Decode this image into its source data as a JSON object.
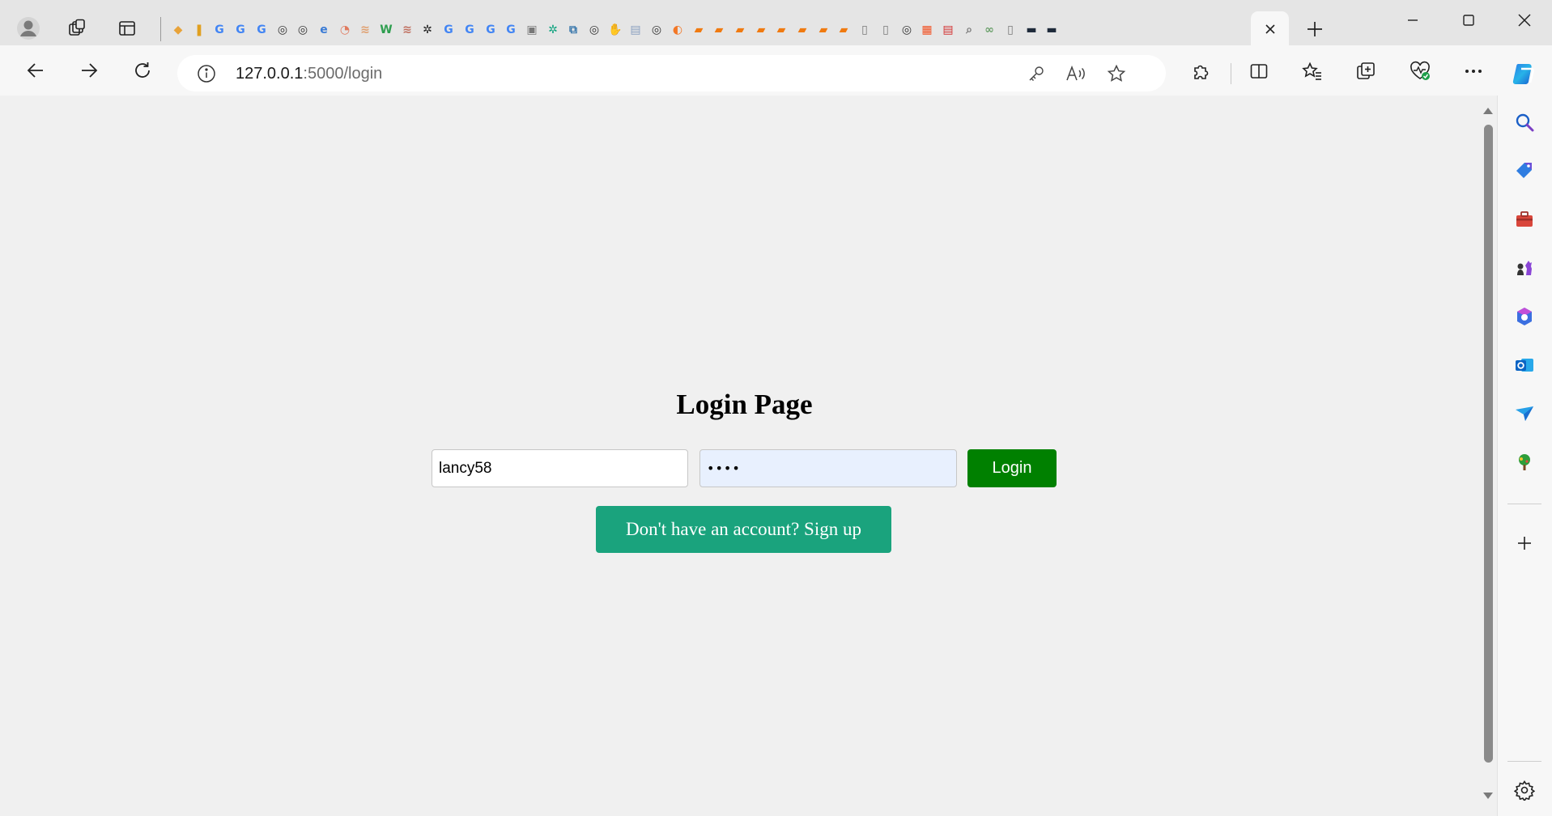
{
  "browser": {
    "address_bar": {
      "host": "127.0.0.1",
      "path": ":5000/login"
    },
    "pinned_tabs": [
      {
        "icon": "multicolor-app-icon",
        "glyph": "◆",
        "color": "#e8a33a"
      },
      {
        "icon": "bars-icon",
        "glyph": "❚",
        "color": "#e0a020"
      },
      {
        "icon": "google-icon",
        "glyph": "G",
        "color": "#4285f4"
      },
      {
        "icon": "google-icon",
        "glyph": "G",
        "color": "#4285f4"
      },
      {
        "icon": "google-icon",
        "glyph": "G",
        "color": "#4285f4"
      },
      {
        "icon": "github-icon",
        "glyph": "◎",
        "color": "#333333"
      },
      {
        "icon": "github-icon",
        "glyph": "◎",
        "color": "#333333"
      },
      {
        "icon": "edge-e-icon",
        "glyph": "e",
        "color": "#3a7bd5"
      },
      {
        "icon": "circle-icon",
        "glyph": "◔",
        "color": "#e07a5f"
      },
      {
        "icon": "stripes-icon",
        "glyph": "≋",
        "color": "#e0a070"
      },
      {
        "icon": "w-icon",
        "glyph": "W",
        "color": "#2e9e4f"
      },
      {
        "icon": "stripes-icon",
        "glyph": "≋",
        "color": "#c07060"
      },
      {
        "icon": "chatgpt-icon",
        "glyph": "✲",
        "color": "#222222"
      },
      {
        "icon": "google-icon",
        "glyph": "G",
        "color": "#4285f4"
      },
      {
        "icon": "google-icon",
        "glyph": "G",
        "color": "#4285f4"
      },
      {
        "icon": "google-icon",
        "glyph": "G",
        "color": "#4285f4"
      },
      {
        "icon": "google-icon",
        "glyph": "G",
        "color": "#4285f4"
      },
      {
        "icon": "image-icon",
        "glyph": "▣",
        "color": "#777777"
      },
      {
        "icon": "chatgpt-icon",
        "glyph": "✲",
        "color": "#10a37f"
      },
      {
        "icon": "python-icon",
        "glyph": "⧉",
        "color": "#3776ab"
      },
      {
        "icon": "github-icon",
        "glyph": "◎",
        "color": "#333333"
      },
      {
        "icon": "hand-icon",
        "glyph": "✋",
        "color": "#c58a4a"
      },
      {
        "icon": "doc-icon",
        "glyph": "▤",
        "color": "#8aa0c0"
      },
      {
        "icon": "github-icon",
        "glyph": "◎",
        "color": "#333333"
      },
      {
        "icon": "jupyter-icon",
        "glyph": "◐",
        "color": "#f37726"
      },
      {
        "icon": "book-icon",
        "glyph": "▰",
        "color": "#f07a10"
      },
      {
        "icon": "book-icon",
        "glyph": "▰",
        "color": "#f07a10"
      },
      {
        "icon": "book-icon",
        "glyph": "▰",
        "color": "#f07a10"
      },
      {
        "icon": "book-icon",
        "glyph": "▰",
        "color": "#f07a10"
      },
      {
        "icon": "book-icon",
        "glyph": "▰",
        "color": "#f07a10"
      },
      {
        "icon": "book-icon",
        "glyph": "▰",
        "color": "#f07a10"
      },
      {
        "icon": "book-icon",
        "glyph": "▰",
        "color": "#f07a10"
      },
      {
        "icon": "book-icon",
        "glyph": "▰",
        "color": "#f07a10"
      },
      {
        "icon": "page-icon",
        "glyph": "▯",
        "color": "#777777"
      },
      {
        "icon": "page-icon",
        "glyph": "▯",
        "color": "#777777"
      },
      {
        "icon": "github-icon",
        "glyph": "◎",
        "color": "#333333"
      },
      {
        "icon": "microsoft-icon",
        "glyph": "▦",
        "color": "#f25022"
      },
      {
        "icon": "pdf-icon",
        "glyph": "▤",
        "color": "#d32f2f"
      },
      {
        "icon": "search-icon",
        "glyph": "⌕",
        "color": "#777777"
      },
      {
        "icon": "link-icon",
        "glyph": "∞",
        "color": "#6aa06a"
      },
      {
        "icon": "page-icon",
        "glyph": "▯",
        "color": "#777777"
      },
      {
        "icon": "terminal-icon",
        "glyph": "▬",
        "color": "#1e2a3a"
      },
      {
        "icon": "terminal-icon",
        "glyph": "▬",
        "color": "#1e2a3a"
      }
    ]
  },
  "page": {
    "title": "Login Page",
    "username_value": "lancy58",
    "password_mask": "••••",
    "login_label": "Login",
    "signup_label": "Don't have an account? Sign up"
  },
  "colors": {
    "login_button": "#008000",
    "signup_button": "#1aa37d",
    "page_background": "#f0f0f0",
    "autofill_background": "#e8f0fe"
  }
}
